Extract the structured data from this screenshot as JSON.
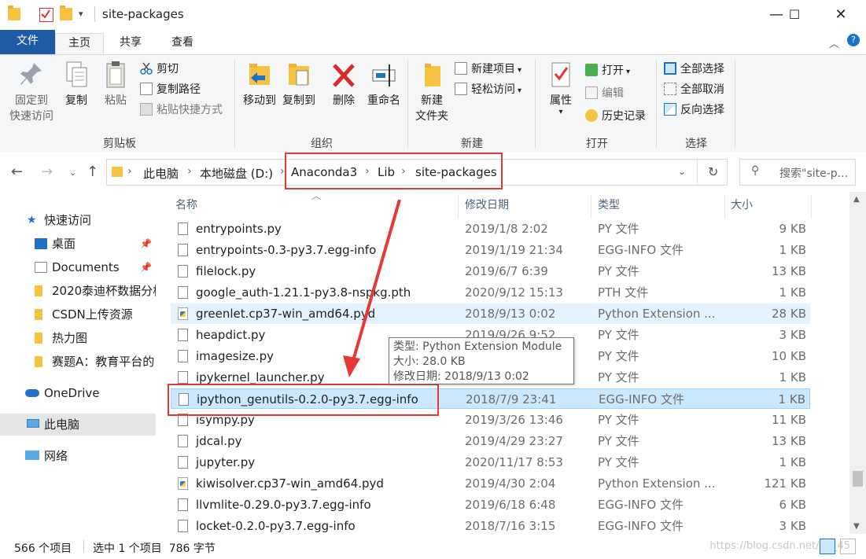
{
  "window": {
    "title": "site-packages",
    "controls": {
      "minimize": "—",
      "maximize": "☐",
      "close": "✕"
    }
  },
  "tabs": {
    "file": "文件",
    "home": "主页",
    "share": "共享",
    "view": "查看"
  },
  "ribbon": {
    "clipboard": {
      "label": "剪贴板",
      "pin": "固定到\n快速访问",
      "pin_l1": "固定到",
      "pin_l2": "快速访问",
      "copy": "复制",
      "paste": "粘贴",
      "cut": "剪切",
      "copy_path": "复制路径",
      "paste_shortcut": "粘贴快捷方式"
    },
    "organize": {
      "label": "组织",
      "move_to": "移动到",
      "copy_to": "复制到",
      "delete": "删除",
      "rename": "重命名"
    },
    "new": {
      "label": "新建",
      "new_folder_l1": "新建",
      "new_folder_l2": "文件夹",
      "new_item": "新建项目",
      "easy_access": "轻松访问"
    },
    "open": {
      "label": "打开",
      "properties": "属性",
      "open": "打开",
      "edit": "编辑",
      "history": "历史记录"
    },
    "select": {
      "label": "选择",
      "select_all": "全部选择",
      "select_none": "全部取消",
      "invert": "反向选择"
    }
  },
  "address": {
    "crumbs": [
      "此电脑",
      "本地磁盘 (D:)",
      "Anaconda3",
      "Lib",
      "site-packages"
    ],
    "search_placeholder": "搜索\"site-p..."
  },
  "nav": {
    "quick_access": "快速访问",
    "items": [
      {
        "label": "桌面"
      },
      {
        "label": "Documents"
      },
      {
        "label": "2020泰迪杯数据分析"
      },
      {
        "label": "CSDN上传资源"
      },
      {
        "label": "热力图"
      },
      {
        "label": "赛题A：教育平台的"
      }
    ],
    "onedrive": "OneDrive",
    "this_pc": "此电脑",
    "network": "网络"
  },
  "columns": {
    "name": "名称",
    "date": "修改日期",
    "type": "类型",
    "size": "大小"
  },
  "files": [
    {
      "name": "entrypoints.py",
      "date": "2019/1/8 2:02",
      "type": "PY 文件",
      "size": "9 KB",
      "icon": "file-icon"
    },
    {
      "name": "entrypoints-0.3-py3.7.egg-info",
      "date": "2019/1/19 21:34",
      "type": "EGG-INFO 文件",
      "size": "1 KB",
      "icon": "file-icon"
    },
    {
      "name": "filelock.py",
      "date": "2019/6/7 6:39",
      "type": "PY 文件",
      "size": "13 KB",
      "icon": "file-icon"
    },
    {
      "name": "google_auth-1.21.1-py3.8-nspkg.pth",
      "date": "2020/9/12 15:13",
      "type": "PTH 文件",
      "size": "1 KB",
      "icon": "file-icon"
    },
    {
      "name": "greenlet.cp37-win_amd64.pyd",
      "date": "2018/9/13 0:02",
      "type": "Python Extension ...",
      "size": "28 KB",
      "icon": "python-icon"
    },
    {
      "name": "heapdict.py",
      "date": "2019/9/26 9:52",
      "type": "PY 文件",
      "size": "3 KB",
      "icon": "file-icon"
    },
    {
      "name": "imagesize.py",
      "date": "2019/3/25 13:23",
      "type": "PY 文件",
      "size": "10 KB",
      "icon": "file-icon"
    },
    {
      "name": "ipykernel_launcher.py",
      "date": "2019/3/25 13:23",
      "type": "PY 文件",
      "size": "1 KB",
      "icon": "file-icon"
    },
    {
      "name": "ipython_genutils-0.2.0-py3.7.egg-info",
      "date": "2018/7/9 23:41",
      "type": "EGG-INFO 文件",
      "size": "1 KB",
      "icon": "file-icon"
    },
    {
      "name": "isympy.py",
      "date": "2019/3/26 13:46",
      "type": "PY 文件",
      "size": "11 KB",
      "icon": "file-icon"
    },
    {
      "name": "jdcal.py",
      "date": "2019/4/29 23:27",
      "type": "PY 文件",
      "size": "13 KB",
      "icon": "file-icon"
    },
    {
      "name": "jupyter.py",
      "date": "2020/11/17 8:53",
      "type": "PY 文件",
      "size": "1 KB",
      "icon": "file-icon"
    },
    {
      "name": "kiwisolver.cp37-win_amd64.pyd",
      "date": "2019/4/30 2:04",
      "type": "Python Extension ...",
      "size": "121 KB",
      "icon": "python-icon"
    },
    {
      "name": "llvmlite-0.29.0-py3.7.egg-info",
      "date": "2019/6/18 6:48",
      "type": "EGG-INFO 文件",
      "size": "6 KB",
      "icon": "file-icon"
    },
    {
      "name": "locket-0.2.0-py3.7.egg-info",
      "date": "2018/7/16 3:15",
      "type": "EGG-INFO 文件",
      "size": "3 KB",
      "icon": "file-icon"
    }
  ],
  "tooltip": {
    "type": "类型: Python Extension Module",
    "size": "大小: 28.0 KB",
    "modified": "修改日期: 2018/9/13 0:02"
  },
  "status": {
    "count": "566 个项目",
    "selected": "选中 1 个项目  786 字节",
    "watermark": "https://blog.csdn.net/qq_45"
  },
  "colors": {
    "file_tab": "#1f5aa6",
    "selection": "#cce8ff",
    "hover": "#e5f3ff",
    "annotation_red": "#e53935"
  }
}
